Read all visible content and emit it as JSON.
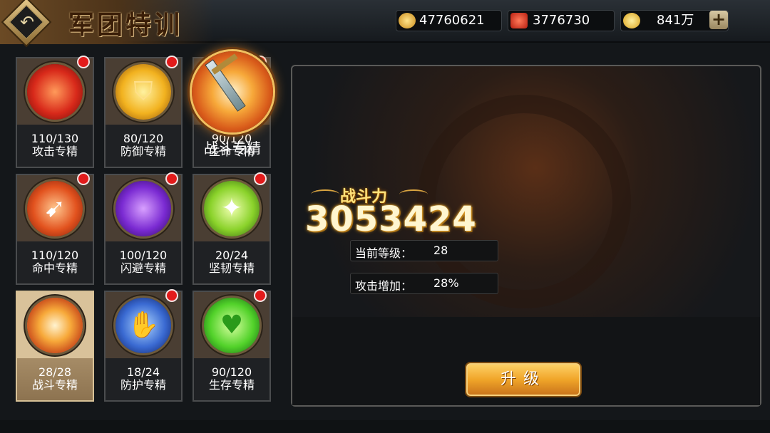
{
  "header": {
    "title": "军团特训",
    "resources": [
      {
        "icon": "gold-ingot-icon",
        "value": "47760621"
      },
      {
        "icon": "star-medal-icon",
        "value": "3776730"
      },
      {
        "icon": "coin-icon",
        "value": "841万"
      }
    ],
    "add_label": "+"
  },
  "skills": [
    {
      "progress": "110/130",
      "name": "攻击专精",
      "icon": "attack-drum-icon",
      "dot": true,
      "selected": false
    },
    {
      "progress": "80/120",
      "name": "防御专精",
      "icon": "shield-icon",
      "dot": true,
      "selected": false
    },
    {
      "progress": "90/120",
      "name": "生命专精",
      "icon": "heart-ripple-icon",
      "dot": true,
      "selected": false
    },
    {
      "progress": "110/120",
      "name": "命中专精",
      "icon": "arrow-hit-icon",
      "dot": true,
      "selected": false
    },
    {
      "progress": "100/120",
      "name": "闪避专精",
      "icon": "silhouette-dodge-icon",
      "dot": true,
      "selected": false
    },
    {
      "progress": "20/24",
      "name": "坚韧专精",
      "icon": "figure-ring-icon",
      "dot": true,
      "selected": false
    },
    {
      "progress": "28/28",
      "name": "战斗专精",
      "icon": "sword-vortex-icon",
      "dot": false,
      "selected": true
    },
    {
      "progress": "18/24",
      "name": "防护专精",
      "icon": "hand-guard-icon",
      "dot": true,
      "selected": false
    },
    {
      "progress": "90/120",
      "name": "生存专精",
      "icon": "heart-cross-icon",
      "dot": true,
      "selected": false
    }
  ],
  "detail": {
    "skill_name": "战斗专精",
    "power_label": "战斗力",
    "power_value": "3053424",
    "stats": [
      {
        "label": "当前等级：",
        "value": "28"
      },
      {
        "label": "攻击增加：",
        "value": "28%"
      }
    ],
    "upgrade_label": "升级"
  }
}
